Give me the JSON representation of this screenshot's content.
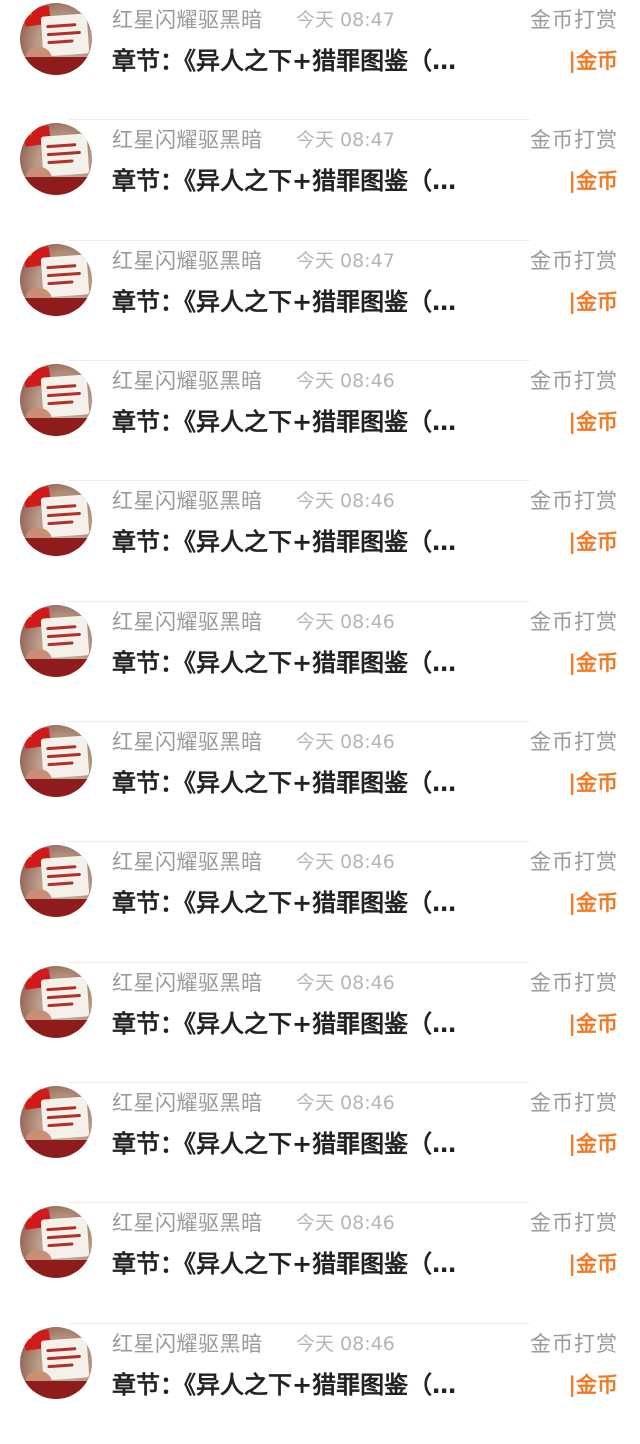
{
  "items": [
    {
      "username": "红星闪耀驱黑暗",
      "time": "今天 08:47",
      "reward_label": "金币打赏",
      "chapter": "章节：《异人之下+猎罪图鉴（…",
      "coin": "|金币"
    },
    {
      "username": "红星闪耀驱黑暗",
      "time": "今天 08:47",
      "reward_label": "金币打赏",
      "chapter": "章节：《异人之下+猎罪图鉴（…",
      "coin": "|金币"
    },
    {
      "username": "红星闪耀驱黑暗",
      "time": "今天 08:47",
      "reward_label": "金币打赏",
      "chapter": "章节：《异人之下+猎罪图鉴（…",
      "coin": "|金币"
    },
    {
      "username": "红星闪耀驱黑暗",
      "time": "今天 08:46",
      "reward_label": "金币打赏",
      "chapter": "章节：《异人之下+猎罪图鉴（…",
      "coin": "|金币"
    },
    {
      "username": "红星闪耀驱黑暗",
      "time": "今天 08:46",
      "reward_label": "金币打赏",
      "chapter": "章节：《异人之下+猎罪图鉴（…",
      "coin": "|金币"
    },
    {
      "username": "红星闪耀驱黑暗",
      "time": "今天 08:46",
      "reward_label": "金币打赏",
      "chapter": "章节：《异人之下+猎罪图鉴（…",
      "coin": "|金币"
    },
    {
      "username": "红星闪耀驱黑暗",
      "time": "今天 08:46",
      "reward_label": "金币打赏",
      "chapter": "章节：《异人之下+猎罪图鉴（…",
      "coin": "|金币"
    },
    {
      "username": "红星闪耀驱黑暗",
      "time": "今天 08:46",
      "reward_label": "金币打赏",
      "chapter": "章节：《异人之下+猎罪图鉴（…",
      "coin": "|金币"
    },
    {
      "username": "红星闪耀驱黑暗",
      "time": "今天 08:46",
      "reward_label": "金币打赏",
      "chapter": "章节：《异人之下+猎罪图鉴（…",
      "coin": "|金币"
    },
    {
      "username": "红星闪耀驱黑暗",
      "time": "今天 08:46",
      "reward_label": "金币打赏",
      "chapter": "章节：《异人之下+猎罪图鉴（…",
      "coin": "|金币"
    },
    {
      "username": "红星闪耀驱黑暗",
      "time": "今天 08:46",
      "reward_label": "金币打赏",
      "chapter": "章节：《异人之下+猎罪图鉴（…",
      "coin": "|金币"
    },
    {
      "username": "红星闪耀驱黑暗",
      "time": "今天 08:46",
      "reward_label": "金币打赏",
      "chapter": "章节：《异人之下+猎罪图鉴（…",
      "coin": "|金币"
    }
  ],
  "colors": {
    "username": "#9a9a9a",
    "time": "#b5b5b5",
    "chapter": "#222222",
    "coin_accent": "#f07a26"
  },
  "icons": {
    "avatar": "user-avatar-image"
  }
}
